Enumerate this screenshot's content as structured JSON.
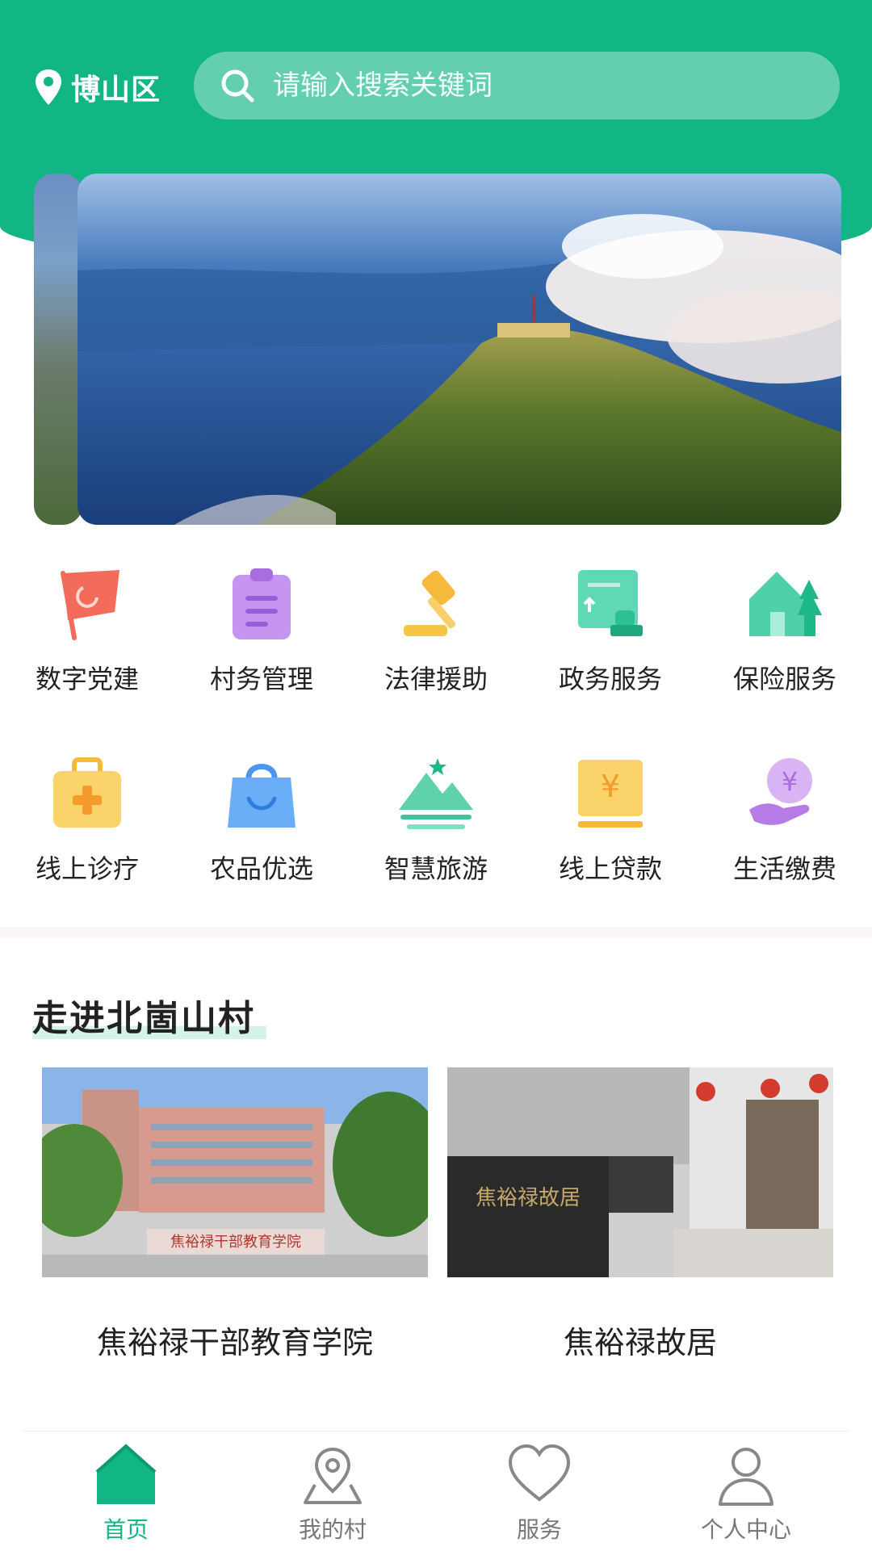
{
  "header": {
    "location": "博山区",
    "search_placeholder": "请输入搜索关键词"
  },
  "banner": {
    "image": "mountain-clouds-photo"
  },
  "services": [
    {
      "label": "数字党建",
      "icon": "party-flag-icon"
    },
    {
      "label": "村务管理",
      "icon": "clipboard-icon"
    },
    {
      "label": "法律援助",
      "icon": "gavel-icon"
    },
    {
      "label": "政务服务",
      "icon": "certificate-stamp-icon"
    },
    {
      "label": "保险服务",
      "icon": "house-tree-icon"
    },
    {
      "label": "线上诊疗",
      "icon": "medical-kit-icon"
    },
    {
      "label": "农品优选",
      "icon": "shopping-bag-icon"
    },
    {
      "label": "智慧旅游",
      "icon": "mountain-star-icon"
    },
    {
      "label": "线上贷款",
      "icon": "yen-card-icon"
    },
    {
      "label": "生活缴费",
      "icon": "yen-hand-icon"
    }
  ],
  "section": {
    "title": "走进北崮山村",
    "cards": [
      {
        "title": "焦裕禄干部教育学院",
        "image": "academy-building-photo"
      },
      {
        "title": "焦裕禄故居",
        "image": "former-residence-photo"
      }
    ]
  },
  "tabbar": [
    {
      "label": "首页",
      "icon": "home-icon",
      "active": true
    },
    {
      "label": "我的村",
      "icon": "map-pin-icon",
      "active": false
    },
    {
      "label": "服务",
      "icon": "heart-icon",
      "active": false
    },
    {
      "label": "个人中心",
      "icon": "user-icon",
      "active": false
    }
  ],
  "colors": {
    "brand": "#12b584",
    "text": "#222222",
    "tab_inactive": "#777777"
  }
}
